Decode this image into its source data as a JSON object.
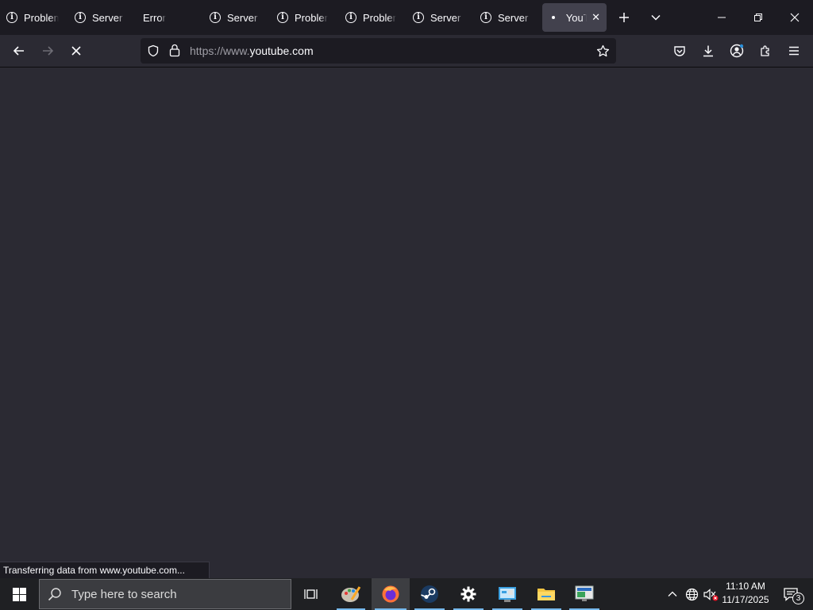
{
  "tabs": [
    {
      "label": "Problem",
      "icon": "info-icon"
    },
    {
      "label": "Server Not Found",
      "icon": "info-icon"
    },
    {
      "label": "Error",
      "icon": ""
    },
    {
      "label": "Server Not Found",
      "icon": "info-icon"
    },
    {
      "label": "Problem",
      "icon": "info-icon"
    },
    {
      "label": "Problem",
      "icon": "info-icon"
    },
    {
      "label": "Server Not Found",
      "icon": "info-icon"
    },
    {
      "label": "Server Not Found",
      "icon": "info-icon"
    },
    {
      "label": "YouTube",
      "icon": "loading-dot",
      "active": true
    }
  ],
  "url": {
    "prefix": "https://www.",
    "host": "youtube.com"
  },
  "status_text": "Transferring data from www.youtube.com...",
  "taskbar": {
    "search_placeholder": "Type here to search",
    "time": "11:10 AM",
    "date": "11/17/2025",
    "notification_count": "3"
  },
  "colors": {
    "tabbar_bg": "#1c1b22",
    "toolbar_bg": "#2b2a33",
    "active_tab_bg": "#42414d",
    "taskbar_bg": "#1f2023",
    "accent": "#76b9ed"
  }
}
